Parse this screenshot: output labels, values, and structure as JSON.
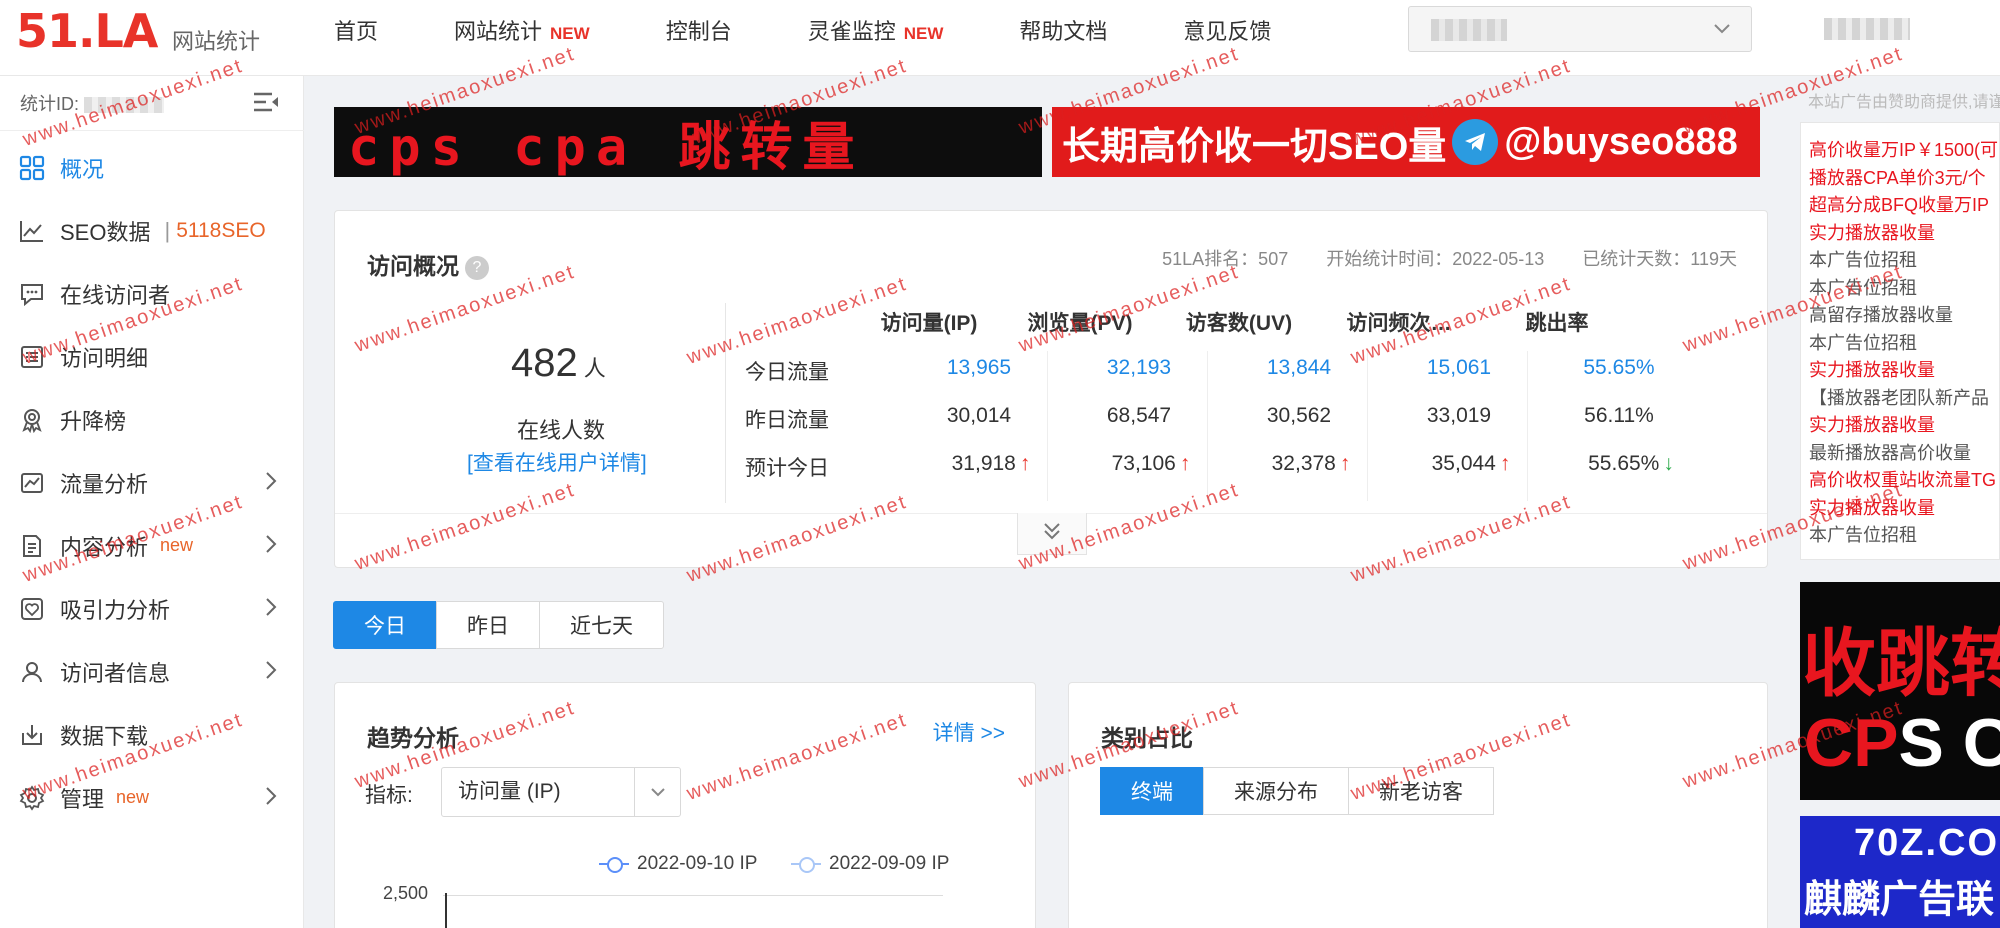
{
  "header": {
    "logo_text": "51.LA",
    "logo_subtitle": "网站统计",
    "nav": [
      {
        "label": "首页",
        "badge": ""
      },
      {
        "label": "网站统计",
        "badge": "NEW"
      },
      {
        "label": "控制台",
        "badge": ""
      },
      {
        "label": "灵雀监控",
        "badge": "NEW"
      },
      {
        "label": "帮助文档",
        "badge": ""
      },
      {
        "label": "意见反馈",
        "badge": ""
      }
    ]
  },
  "sidebar": {
    "stat_id_label": "统计ID:",
    "items": [
      {
        "label": "概况",
        "icon": "grid-icon",
        "active": true
      },
      {
        "label": "SEO数据",
        "icon": "line-chart-icon",
        "extra": "5118SEO",
        "sep": "|"
      },
      {
        "label": "在线访问者",
        "icon": "chat-icon"
      },
      {
        "label": "访问明细",
        "icon": "list-icon"
      },
      {
        "label": "升降榜",
        "icon": "medal-icon"
      },
      {
        "label": "流量分析",
        "icon": "area-chart-icon",
        "arrow": true
      },
      {
        "label": "内容分析",
        "icon": "document-icon",
        "tag": "new",
        "arrow": true
      },
      {
        "label": "吸引力分析",
        "icon": "heart-icon",
        "arrow": true
      },
      {
        "label": "访问者信息",
        "icon": "user-icon",
        "arrow": true
      },
      {
        "label": "数据下载",
        "icon": "download-icon"
      },
      {
        "label": "管理",
        "icon": "gear-icon",
        "tag": "new",
        "arrow": true
      }
    ]
  },
  "banners": {
    "top_left": "cps  cpa  跳转量",
    "top_right_pre": "长期高价收一切SEO量",
    "top_right_post": "@buyseo888"
  },
  "overview": {
    "title": "访问概况",
    "rank": "51LA排名：507",
    "start_time": "开始统计时间：2022-05-13",
    "days": "已统计天数：119天",
    "online_count": "482",
    "online_unit": "人",
    "online_label": "在线人数",
    "online_link": "[查看在线用户详情]",
    "columns": [
      "访问量(IP)",
      "浏览量(PV)",
      "访客数(UV)",
      "访问频次…",
      "跳出率"
    ],
    "rows": [
      {
        "label": "今日流量",
        "values": [
          "13,965",
          "32,193",
          "13,844",
          "15,061",
          "55.65%"
        ],
        "trend": [
          "",
          "",
          "",
          "",
          ""
        ]
      },
      {
        "label": "昨日流量",
        "values": [
          "30,014",
          "68,547",
          "30,562",
          "33,019",
          "56.11%"
        ],
        "trend": [
          "",
          "",
          "",
          "",
          ""
        ]
      },
      {
        "label": "预计今日",
        "values": [
          "31,918",
          "73,106",
          "32,378",
          "35,044",
          "55.65%"
        ],
        "trend": [
          "↑",
          "↑",
          "↑",
          "↑",
          "↓"
        ]
      }
    ]
  },
  "day_tabs": [
    "今日",
    "昨日",
    "近七天"
  ],
  "trend": {
    "title": "趋势分析",
    "detail_link": "详情 >>",
    "metric_label": "指标:",
    "metric_value": "访问量 (IP)",
    "legend": [
      "2022-09-10 IP",
      "2022-09-09 IP"
    ],
    "y_tick": "2,500",
    "colors": [
      "#5b8ff9",
      "#9fc1f5"
    ]
  },
  "category": {
    "title": "类别占比",
    "tabs": [
      "终端",
      "来源分布",
      "新老访客"
    ]
  },
  "ads": {
    "note": "本站广告由赞助商提供,请谨",
    "lines": [
      {
        "text": "高价收量万IP￥1500(可",
        "color": "red"
      },
      {
        "text": "播放器CPA单价3元/个",
        "color": "red"
      },
      {
        "text": "超高分成BFQ收量万IP",
        "color": "red"
      },
      {
        "text": "实力播放器收量",
        "color": "red"
      },
      {
        "text": "本广告位招租",
        "color": "gray"
      },
      {
        "text": "本广告位招租",
        "color": "gray"
      },
      {
        "text": "高留存播放器收量",
        "color": "gray"
      },
      {
        "text": "本广告位招租",
        "color": "gray"
      },
      {
        "text": "实力播放器收量",
        "color": "red"
      },
      {
        "text": "【播放器老团队新产品",
        "color": "gray"
      },
      {
        "text": "实力播放器收量",
        "color": "red"
      },
      {
        "text": "最新播放器高价收量",
        "color": "gray"
      },
      {
        "text": "高价收权重站收流量TG",
        "color": "red"
      },
      {
        "text": "实力播放器收量",
        "color": "red"
      },
      {
        "text": "本广告位招租",
        "color": "gray"
      }
    ],
    "banner_red_line1": "收跳转",
    "banner_red_line2_a": "CP",
    "banner_red_line2_b": "S CI",
    "banner_blue_line1": "70Z.CO",
    "banner_blue_line2": "麒麟广告联"
  },
  "watermark": "www.heimaoxuexi.net"
}
